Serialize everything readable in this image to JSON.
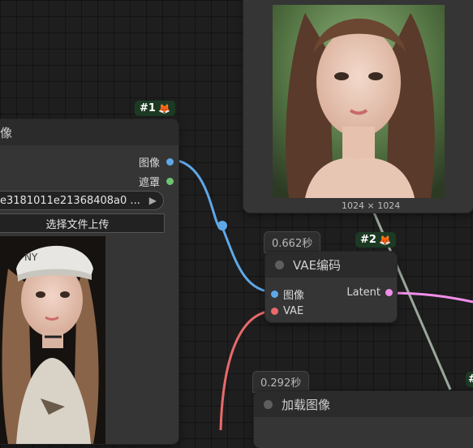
{
  "node_load_image_1": {
    "badge": "#1",
    "title_partial": "像",
    "outputs": [
      "图像",
      "遮罩"
    ],
    "image_combo_value": "e3181011e21368408a0 ...",
    "upload_button_label": "选择文件上传"
  },
  "node_preview": {
    "image_size_caption": "1024 × 1024"
  },
  "node_vae_encode": {
    "badge": "#2",
    "timing": "0.662秒",
    "title": "VAE编码",
    "inputs": [
      "图像",
      "VAE"
    ],
    "output": "Latent"
  },
  "node_load_image_2": {
    "timing": "0.292秒",
    "title": "加载图像"
  },
  "badge_icon": "fox-icon",
  "colors": {
    "image_link": "#5fa8e8",
    "mask_slot": "#6ec372",
    "vae_link": "#e86a6a",
    "latent_link": "#f08ee8",
    "grey_link": "#9aa89c",
    "badge_bg": "#1c3a23"
  }
}
